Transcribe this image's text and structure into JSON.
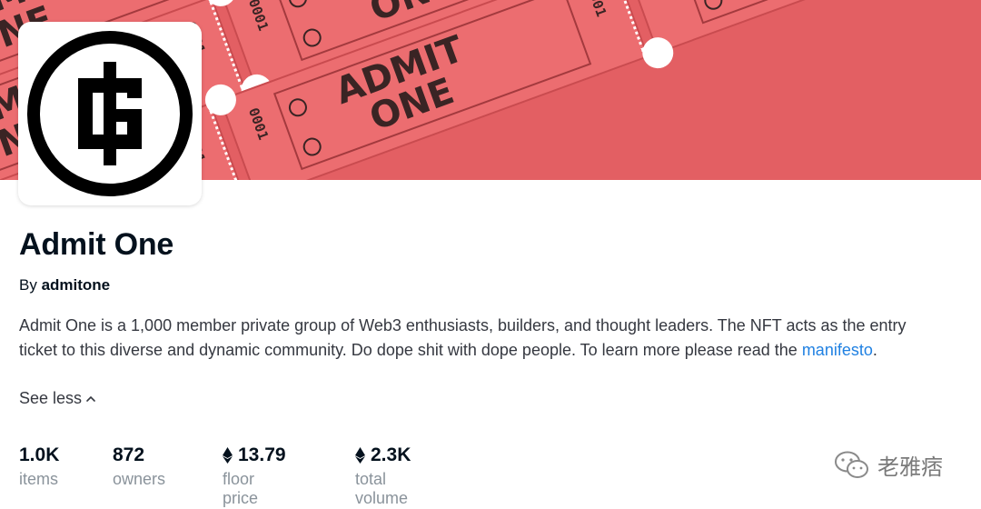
{
  "collection": {
    "name": "Admit One",
    "by_prefix": "By",
    "creator": "admitone",
    "description_before_link": "Admit One is a 1,000 member private group of Web3 enthusiasts, builders, and thought leaders. The NFT acts as the entry ticket to this diverse and dynamic community. Do dope shit with dope people. To learn more please read the ",
    "description_link": "manifesto",
    "description_after_link": ".",
    "see_less_label": "See less"
  },
  "banner": {
    "ticket_text_line1": "ADMIT",
    "ticket_text_line2": "ONE",
    "ticket_serial": "0001",
    "background_color": "#e35f63"
  },
  "stats": [
    {
      "value": "1.0K",
      "label": "items",
      "eth_icon": false
    },
    {
      "value": "872",
      "label": "owners",
      "eth_icon": false
    },
    {
      "value": "13.79",
      "label": "floor price",
      "eth_icon": true
    },
    {
      "value": "2.3K",
      "label": "total volume",
      "eth_icon": true
    }
  ],
  "watermark": {
    "text": "老雅痞",
    "icon": "wechat-icon"
  },
  "colors": {
    "link": "#2081e2",
    "text": "#04111d",
    "muted": "#8a939b"
  }
}
